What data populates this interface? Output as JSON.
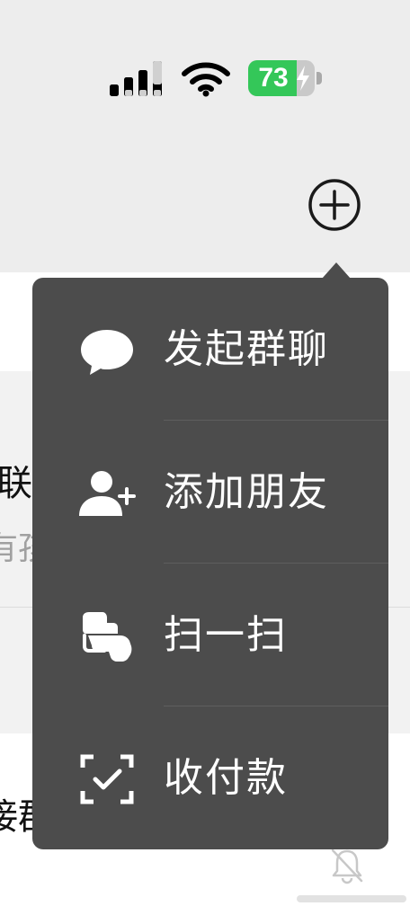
{
  "status_bar": {
    "battery_percent": 73,
    "battery_label": "73",
    "signal_bars_active": 3,
    "colors": {
      "battery": "#34c759",
      "icons": "#000000"
    }
  },
  "header": {
    "add_icon": "plus-circle-icon"
  },
  "background_list": {
    "row1_title_fragment": "联",
    "row1_sub_fragment": "有孩",
    "row2_title_fragment": "接群",
    "muted_icon": "bell-muted-icon"
  },
  "menu": {
    "background_color": "#4c4c4c",
    "items": [
      {
        "label": "发起群聊",
        "icon": "chat-bubble-icon"
      },
      {
        "label": "添加朋友",
        "icon": "add-friend-icon"
      },
      {
        "label": "扫一扫",
        "icon": "scan-icon"
      },
      {
        "label": "收付款",
        "icon": "money-scan-icon"
      }
    ]
  }
}
